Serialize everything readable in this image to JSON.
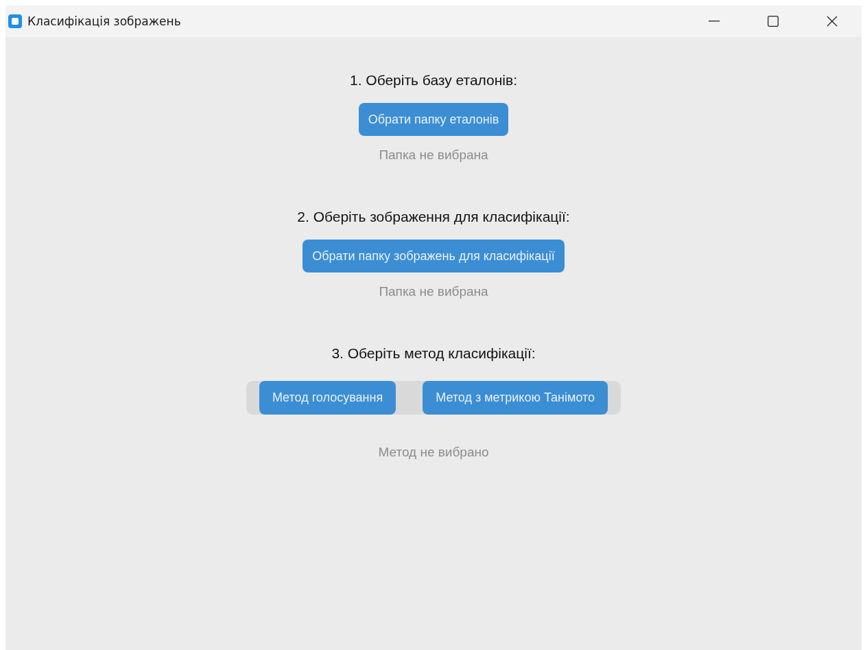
{
  "window": {
    "title": "Класифікація зображень"
  },
  "sections": [
    {
      "heading": "1. Оберіть базу еталонів:",
      "kind": "button",
      "buttons": [
        "Обрати папку еталонів"
      ],
      "status": "Папка не вибрана"
    },
    {
      "heading": "2. Оберіть зображення для класифікації:",
      "kind": "button",
      "buttons": [
        "Обрати папку зображень для класифікації"
      ],
      "status": "Папка не вибрана"
    },
    {
      "heading": "3. Оберіть метод класифікації:",
      "kind": "segmented",
      "buttons": [
        "Метод голосування",
        "Метод з метрикою Танімото"
      ],
      "status": "Метод не вибрано"
    }
  ]
}
